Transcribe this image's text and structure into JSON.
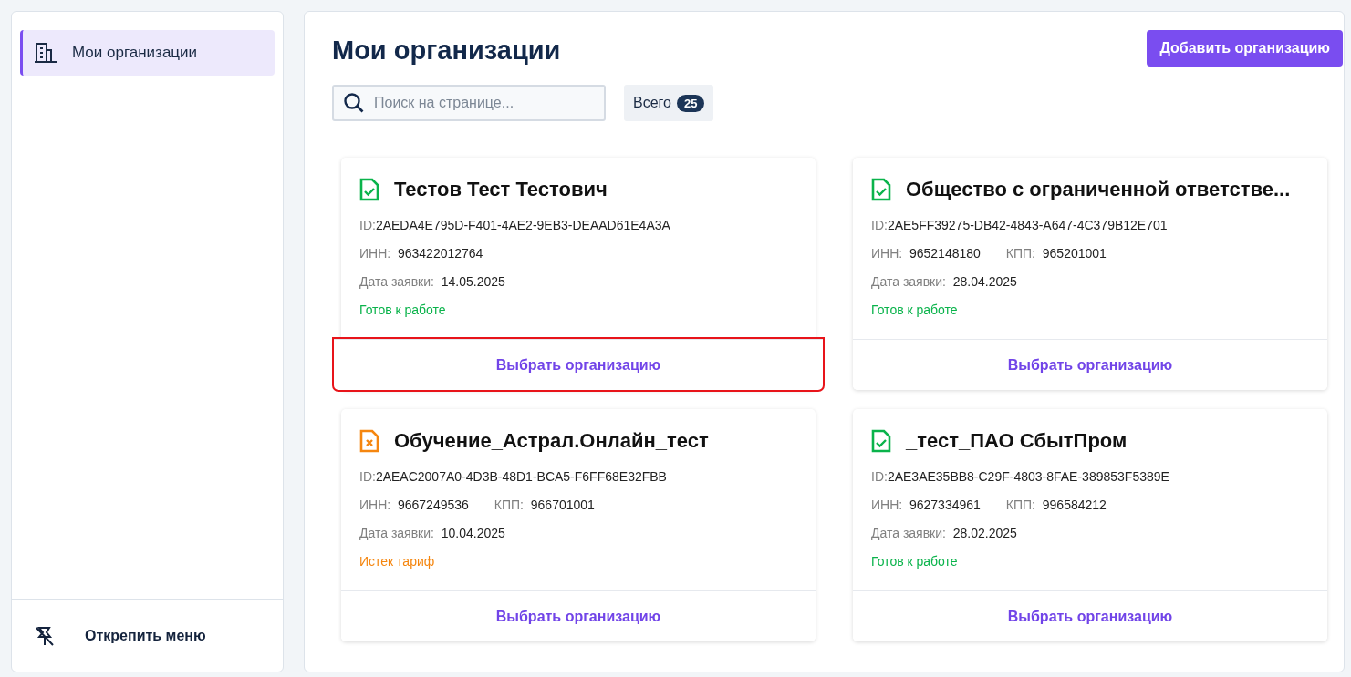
{
  "sidebar": {
    "items": [
      {
        "label": "Мои организации",
        "selected": true
      }
    ],
    "footer": "Открепить меню"
  },
  "page": {
    "title": "Мои организации",
    "add_button": "Добавить организацию",
    "search": {
      "placeholder": "Поиск на странице..."
    },
    "total": {
      "label": "Всего",
      "count": "25"
    }
  },
  "cards": [
    {
      "name": "Тестов Тест Тестович",
      "id_label": "ID:",
      "id": "2AEDA4E795D-F401-4AE2-9EB3-DEAAD61E4A3A",
      "inn_label": "ИНН:",
      "inn": "963422012764",
      "date_label": "Дата заявки:",
      "date": "14.05.2025",
      "status": {
        "kind": "ready",
        "text": "Готов к работе"
      },
      "action": "Выбрать организацию",
      "highlighted": true
    },
    {
      "name": "Общество с ограниченной ответстве...",
      "id_label": "ID:",
      "id": "2AE5FF39275-DB42-4843-A647-4C379B12E701",
      "inn_label": "ИНН:",
      "inn": "9652148180",
      "kpp_label": "КПП:",
      "kpp": "965201001",
      "date_label": "Дата заявки:",
      "date": "28.04.2025",
      "status": {
        "kind": "ready",
        "text": "Готов к работе"
      },
      "action": "Выбрать организацию",
      "highlighted": false
    },
    {
      "name": "Обучение_Астрал.Онлайн_тест",
      "id_label": "ID:",
      "id": "2AEAC2007A0-4D3B-48D1-BCA5-F6FF68E32FBB",
      "inn_label": "ИНН:",
      "inn": "9667249536",
      "kpp_label": "КПП:",
      "kpp": "966701001",
      "date_label": "Дата заявки:",
      "date": "10.04.2025",
      "status": {
        "kind": "expired",
        "text": "Истек тариф"
      },
      "action": "Выбрать организацию",
      "highlighted": false
    },
    {
      "name": "_тест_ПАО СбытПром",
      "id_label": "ID:",
      "id": "2AE3AE35BB8-C29F-4803-8FAE-389853F5389E",
      "inn_label": "ИНН:",
      "inn": "9627334961",
      "kpp_label": "КПП:",
      "kpp": "996584212",
      "date_label": "Дата заявки:",
      "date": "28.02.2025",
      "status": {
        "kind": "ready",
        "text": "Готов к работе"
      },
      "action": "Выбрать организацию",
      "highlighted": false
    }
  ]
}
